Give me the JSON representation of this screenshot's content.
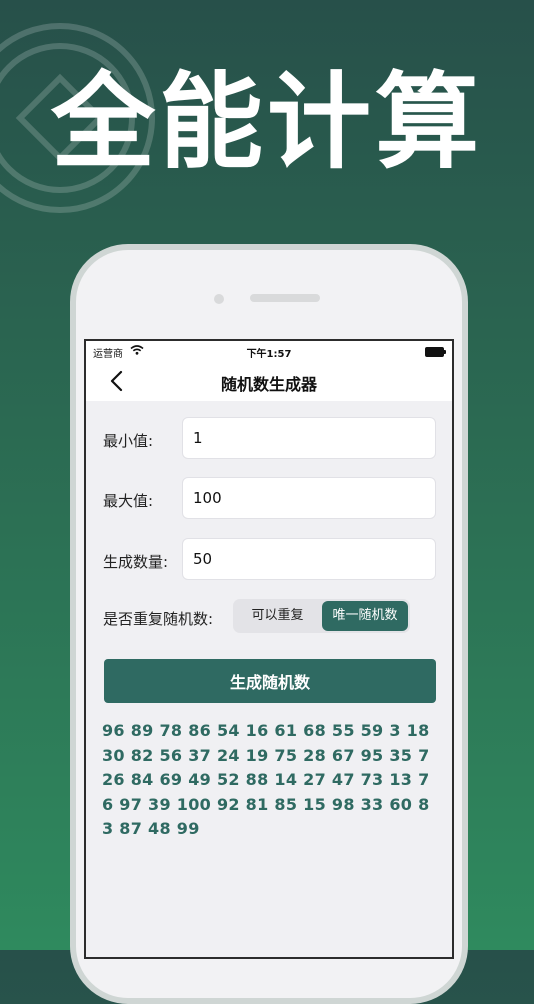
{
  "headline": "全能计算",
  "status_bar": {
    "carrier": "运营商",
    "time": "下午1:57"
  },
  "nav": {
    "title": "随机数生成器"
  },
  "form": {
    "min": {
      "label": "最小值:",
      "value": "1"
    },
    "max": {
      "label": "最大值:",
      "value": "100"
    },
    "count": {
      "label": "生成数量:",
      "value": "50"
    },
    "repeat": {
      "label": "是否重复随机数:",
      "options": [
        "可以重复",
        "唯一随机数"
      ],
      "selected": "唯一随机数"
    }
  },
  "generate_label": "生成随机数",
  "result": "96 89 78 86 54 16 61 68 55 59 3 18 30 82 56 37 24 19 75 28 67 95 35 7 26 84 69 49 52 88 14 27 47 73 13 76 97 39 100 92 81 85 15 98 33 60 83 87 48 99",
  "colors": {
    "accent": "#2f6a62",
    "background_top": "#27504a",
    "background_bottom": "#2f8a5e"
  }
}
